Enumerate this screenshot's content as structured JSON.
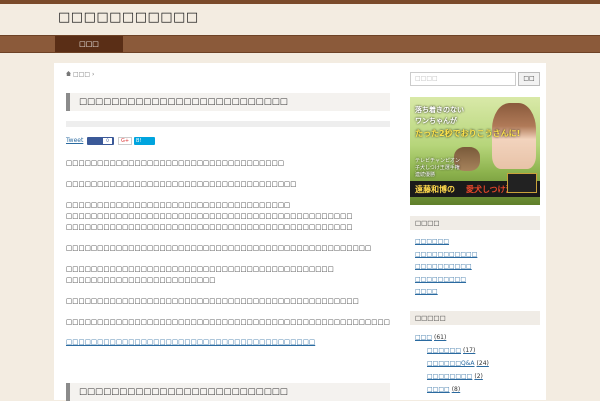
{
  "header": {
    "site_title": "□□□□□□□□□□□"
  },
  "nav": {
    "home_label": "□□□"
  },
  "breadcrumb": {
    "home": "□□□",
    "separator": "›"
  },
  "post": {
    "title": "□□□□□□□□□□□□□□□□□□□□□□□□□□",
    "share": {
      "tweet": "Tweet",
      "fb_count": "0",
      "gplus": "G+",
      "hatena": "B!"
    },
    "paragraphs": [
      [
        "□□□□□□□□□□□□□□□□□□□□□□□□□□□□□□□□□□□"
      ],
      [
        "□□□□□□□□□□□□□□□□□□□□□□□□□□□□□□□□□□□□□"
      ],
      [
        "□□□□□□□□□□□□□□□□□□□□□□□□□□□□□□□□□□□□",
        "□□□□□□□□□□□□□□□□□□□□□□□□□□□□□□□□□□□□□□□□□□□□□□",
        "□□□□□□□□□□□□□□□□□□□□□□□□□□□□□□□□□□□□□□□□□□□□□□"
      ],
      [
        "□□□□□□□□□□□□□□□□□□□□□□□□□□□□□□□□□□□□□□□□□□□□□□□□□"
      ],
      [
        "□□□□□□□□□□□□□□□□□□□□□□□□□□□□□□□□□□□□□□□□□□□",
        "□□□□□□□□□□□□□□□□□□□□□□□□"
      ],
      [
        "□□□□□□□□□□□□□□□□□□□□□□□□□□□□□□□□□□□□□□□□□□□□□□□"
      ],
      [
        "□□□□□□□□□□□□□□□□□□□□□□□□□□□□□□□□□□□□□□□□□□□□□□□□□□□□□□□□□□□□□□□□□□□□□□□□□"
      ]
    ],
    "link": "□□□□□□□□□□□□□□□□□□□□□□□□□□□□□□□□□□□□□□□□",
    "subheading": "□□□□□□□□□□□□□□□□□□□□□□□□□□"
  },
  "sidebar": {
    "search": {
      "placeholder": "□□□□",
      "button": "□□"
    },
    "banner": {
      "line1": "落ち着きのない",
      "line2": "ワンちゃんが",
      "line3": "たった2秒でおりこうさんに!",
      "cap1": "テレビチャンピオン",
      "cap2": "子犬しつけ王選手権",
      "cap3": "連続優勝",
      "method_name": "遠藤和博の",
      "method_em": "愛犬しつけ法"
    },
    "recent": {
      "title": "□□□□",
      "items": [
        "□□□□□□",
        "□□□□□□□□□□□",
        "□□□□□□□□□□",
        "□□□□□□□□□",
        "□□□□"
      ]
    },
    "categories": {
      "title": "□□□□□",
      "items": [
        {
          "label": "□□□",
          "count": "(61)",
          "level": 0
        },
        {
          "label": "□□□□□□",
          "count": "(17)",
          "level": 1
        },
        {
          "label": "□□□□□□Q&A",
          "count": "(24)",
          "level": 1
        },
        {
          "label": "□□□□□□□□",
          "count": "(2)",
          "level": 1
        },
        {
          "label": "□□□□",
          "count": "(8)",
          "level": 1
        }
      ]
    }
  },
  "colors": {
    "nav_bg": "#8b5a3a",
    "nav_active": "#5a2e16",
    "page_bg": "#f3ece1",
    "link": "#2a6aa0"
  }
}
